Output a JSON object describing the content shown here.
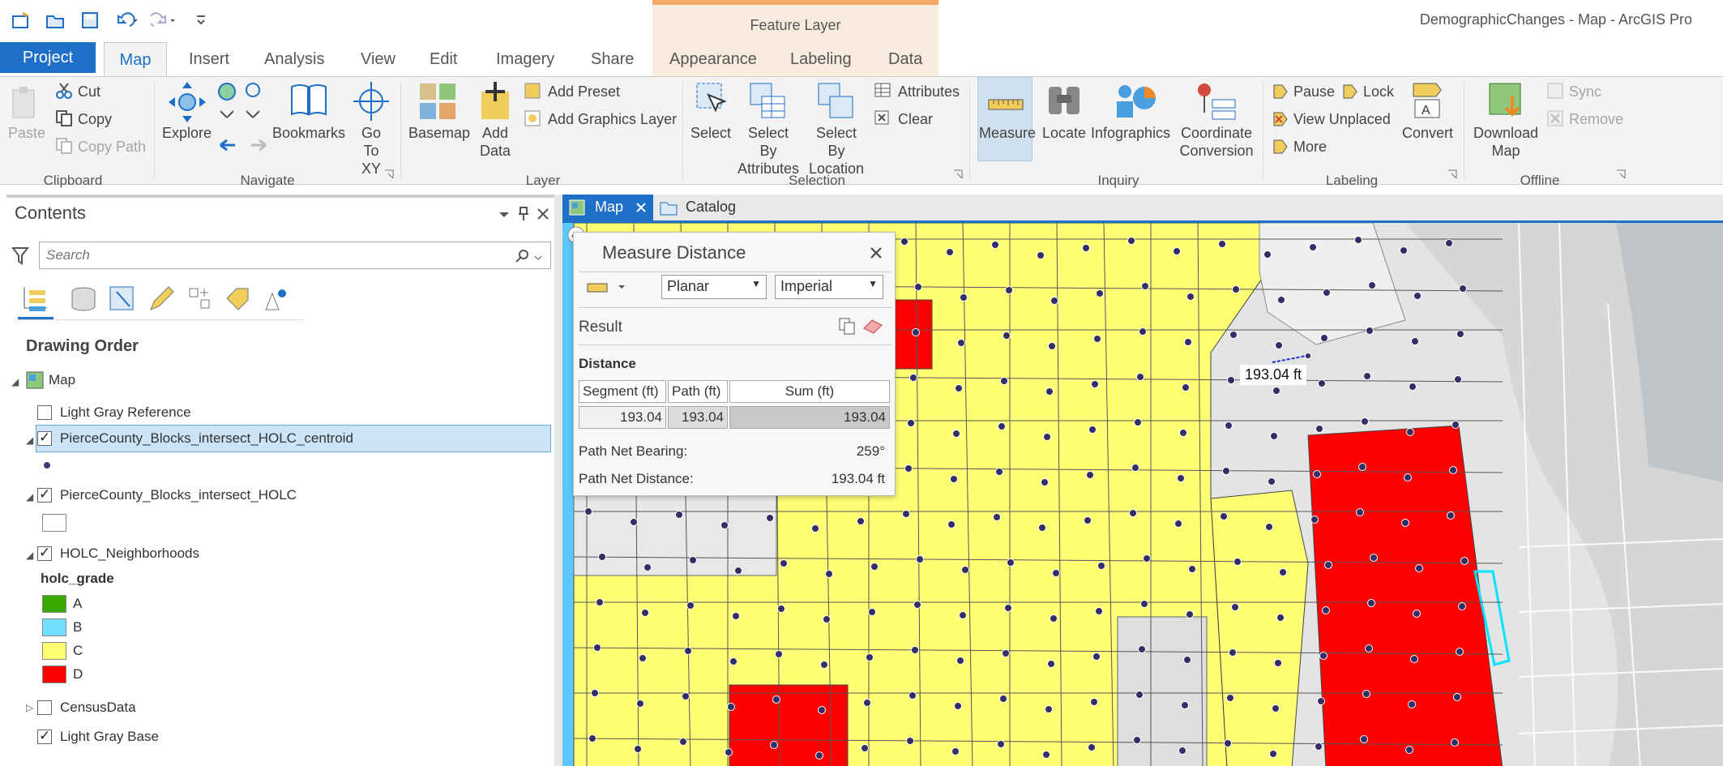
{
  "window": {
    "title": "DemographicChanges - Map - ArcGIS Pro",
    "context_tab_group": "Feature Layer"
  },
  "tabs": {
    "project": "Project",
    "items": [
      "Map",
      "Insert",
      "Analysis",
      "View",
      "Edit",
      "Imagery",
      "Share",
      "Appearance",
      "Labeling",
      "Data"
    ]
  },
  "ribbon": {
    "clipboard": {
      "group": "Clipboard",
      "paste": "Paste",
      "cut": "Cut",
      "copy": "Copy",
      "copy_path": "Copy Path"
    },
    "navigate": {
      "group": "Navigate",
      "explore": "Explore",
      "bookmarks": "Bookmarks",
      "goto1": "Go",
      "goto2": "To XY"
    },
    "layer": {
      "group": "Layer",
      "basemap": "Basemap",
      "add_data1": "Add",
      "add_data2": "Data",
      "add_preset": "Add Preset",
      "add_graphics": "Add Graphics Layer"
    },
    "selection": {
      "group": "Selection",
      "select": "Select",
      "by_attr1": "Select By",
      "by_attr2": "Attributes",
      "by_loc1": "Select By",
      "by_loc2": "Location",
      "attributes": "Attributes",
      "clear": "Clear"
    },
    "inquiry": {
      "group": "Inquiry",
      "measure": "Measure",
      "locate": "Locate",
      "infographics": "Infographics",
      "coord1": "Coordinate",
      "coord2": "Conversion"
    },
    "labeling": {
      "group": "Labeling",
      "pause": "Pause",
      "lock": "Lock",
      "view_unplaced": "View Unplaced",
      "more": "More",
      "convert": "Convert"
    },
    "offline": {
      "group": "Offline",
      "download1": "Download",
      "download2": "Map",
      "sync": "Sync",
      "remove": "Remove"
    }
  },
  "contents": {
    "title": "Contents",
    "search_placeholder": "Search",
    "drawing_order": "Drawing Order",
    "map": "Map",
    "layers": {
      "light_gray_ref": "Light Gray Reference",
      "centroid": "PierceCounty_Blocks_intersect_HOLC_centroid",
      "blocks": "PierceCounty_Blocks_intersect_HOLC",
      "holc": "HOLC_Neighborhoods",
      "holc_field": "holc_grade",
      "grades": [
        {
          "label": "A",
          "color": "#38a800"
        },
        {
          "label": "B",
          "color": "#73dfff"
        },
        {
          "label": "C",
          "color": "#ffff73"
        },
        {
          "label": "D",
          "color": "#ff0000"
        }
      ],
      "census": "CensusData",
      "light_gray_base": "Light Gray Base"
    }
  },
  "view_tabs": {
    "map": "Map",
    "catalog": "Catalog"
  },
  "measure": {
    "title": "Measure Distance",
    "mode": "Planar",
    "units": "Imperial",
    "result": "Result",
    "distance": "Distance",
    "headers": [
      "Segment (ft)",
      "Path (ft)",
      "Sum (ft)"
    ],
    "values": [
      "193.04",
      "193.04",
      "193.04"
    ],
    "bearing_label": "Path Net Bearing:",
    "bearing_value": "259°",
    "net_label": "Path Net Distance:",
    "net_value": "193.04 ft"
  },
  "map_label": "193.04 ft",
  "colors": {
    "accent": "#1d6fc8",
    "grade_c": "#ffff73",
    "grade_d": "#ff0000",
    "selection": "#00ffff"
  }
}
